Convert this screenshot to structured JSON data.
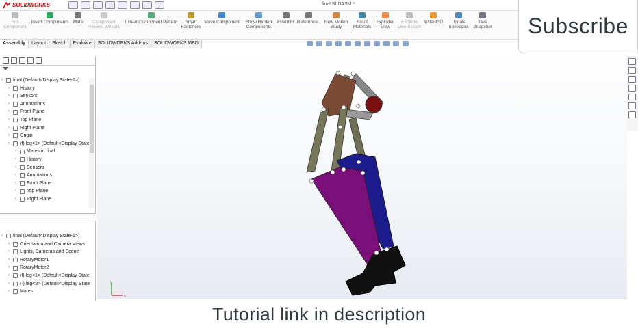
{
  "app": {
    "logo": "SOLIDWORKS",
    "doc_title": "final.SLDASM *"
  },
  "ribbon": [
    {
      "label": "Edit\nComponent",
      "disabled": true
    },
    {
      "label": "Insert Components",
      "disabled": false
    },
    {
      "label": "Mate",
      "disabled": false
    },
    {
      "label": "Component\nPreview Window",
      "disabled": true
    },
    {
      "label": "Linear Component Pattern",
      "disabled": false
    },
    {
      "label": "Smart\nFasteners",
      "disabled": false
    },
    {
      "label": "Move Component",
      "disabled": false
    },
    {
      "label": "Show Hidden\nComponents",
      "disabled": false
    },
    {
      "label": "Assembl...",
      "disabled": false
    },
    {
      "label": "Reference...",
      "disabled": false
    },
    {
      "label": "New Motion\nStudy",
      "disabled": false
    },
    {
      "label": "Bill of\nMaterials",
      "disabled": false
    },
    {
      "label": "Exploded\nView",
      "disabled": false
    },
    {
      "label": "Explode\nLine Sketch",
      "disabled": true
    },
    {
      "label": "Instant3D",
      "disabled": false
    },
    {
      "label": "Update\nSpeedpak",
      "disabled": false
    },
    {
      "label": "Take\nSnapshot",
      "disabled": false
    }
  ],
  "command_tabs": [
    "Assembly",
    "Layout",
    "Sketch",
    "Evaluate",
    "SOLIDWORKS Add-Ins",
    "SOLIDWORKS MBD"
  ],
  "feature_tree": [
    {
      "label": "final  (Default<Display State-1>)",
      "indent": 0
    },
    {
      "label": "History",
      "indent": 1
    },
    {
      "label": "Sensors",
      "indent": 1
    },
    {
      "label": "Annotations",
      "indent": 1
    },
    {
      "label": "Front Plane",
      "indent": 1
    },
    {
      "label": "Top Plane",
      "indent": 1
    },
    {
      "label": "Right Plane",
      "indent": 1
    },
    {
      "label": "Origin",
      "indent": 1
    },
    {
      "label": "(f) leg<1> (Default<Display State",
      "indent": 1
    },
    {
      "label": "Mates in final",
      "indent": 2
    },
    {
      "label": "History",
      "indent": 2
    },
    {
      "label": "Sensors",
      "indent": 2
    },
    {
      "label": "Annotations",
      "indent": 2
    },
    {
      "label": "Front Plane",
      "indent": 2
    },
    {
      "label": "Top Plane",
      "indent": 2
    },
    {
      "label": "Right Plane",
      "indent": 2
    }
  ],
  "motion_tree": [
    {
      "label": "final  (Default<Display State-1>)",
      "indent": 0
    },
    {
      "label": "Orientation and Camera Views",
      "indent": 1
    },
    {
      "label": "Lights, Cameras and Scene",
      "indent": 1
    },
    {
      "label": "RotaryMotor1",
      "indent": 1
    },
    {
      "label": "RotaryMotor2",
      "indent": 1
    },
    {
      "label": "(f) leg<1> (Default<Display State",
      "indent": 1
    },
    {
      "label": "(-) leg<2> (Default<Display State",
      "indent": 1
    },
    {
      "label": "Mates",
      "indent": 1
    }
  ],
  "overlay": {
    "subscribe": "Subscribe",
    "caption": "Tutorial link in description"
  },
  "colors": {
    "purple": "#7a0f7a",
    "navy": "#1c1c8c",
    "brown": "#7a4a34",
    "olive": "#77775a",
    "grey": "#777777",
    "maroon": "#7a1010"
  }
}
